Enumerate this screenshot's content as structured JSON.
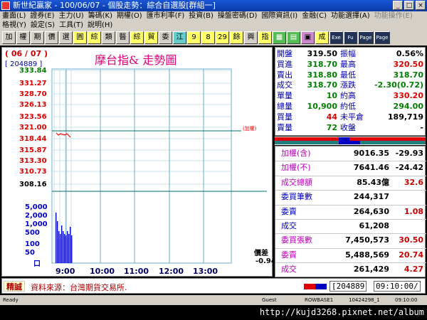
{
  "window": {
    "title": "新世紀贏家 - 100/06/07 - 個股走勢：綜合自選股[群組一]",
    "minimize": "_",
    "maximize": "□",
    "close": "×"
  },
  "menu": {
    "row1": [
      "畫面(L)",
      "證券(E)",
      "主力(U)",
      "籌碼(K)",
      "期權(O)",
      "匯市利率(F)",
      "投資(B)",
      "操盤密碼(D)",
      "國際資訊(I)",
      "金融(C)",
      "功能選擇(A)",
      "功能操作(E)"
    ],
    "row2": [
      "格視(Y)",
      "設定(S)",
      "工具(T)",
      "說明(H)"
    ]
  },
  "toolbar": [
    "加",
    "權",
    "期",
    "價",
    "選",
    "圓",
    "綜",
    "類",
    "醫",
    "綜",
    "貿",
    "委",
    "江",
    "9",
    "8",
    "29",
    "餘",
    "興",
    "指",
    "▦",
    "▤",
    "▣",
    "成",
    "Exe",
    "Fu",
    "Page",
    "Page"
  ],
  "chart": {
    "date": "( 06 / 07 )",
    "code": "[ 204889 ]",
    "title": "摩台指& 走勢圖",
    "price_ticks": [
      "333.84",
      "331.27",
      "328.70",
      "326.13",
      "323.56",
      "321.00",
      "318.44",
      "315.87",
      "313.30",
      "310.73",
      "308.16"
    ],
    "volume_ticks": [
      "5,000",
      "2,000",
      "1,000",
      "500",
      "100",
      "50",
      "口"
    ],
    "times": [
      "9:00",
      "10:00",
      "11:00",
      "12:00",
      "13:00"
    ],
    "ref_note": "(加權)",
    "spread_label": "價差",
    "spread_value": "-0.94"
  },
  "quote": {
    "rows": [
      {
        "l1": "開盤",
        "v1": "319.50",
        "l2": "振幅",
        "v2": "0.56%"
      },
      {
        "l1": "買進",
        "v1": "318.70",
        "l2": "最高",
        "v2": "320.50"
      },
      {
        "l1": "賣出",
        "v1": "318.80",
        "l2": "最低",
        "v2": "318.70"
      },
      {
        "l1": "成交",
        "v1": "318.70",
        "l2": "漲跌",
        "v2": "-2.30(0.72)"
      },
      {
        "l1": "單量",
        "v1": "10",
        "l2": "約高",
        "v2": "330.20"
      },
      {
        "l1": "總量",
        "v1": "10,900",
        "l2": "約低",
        "v2": "294.00"
      },
      {
        "l1": "買量",
        "v1": "44",
        "l2": "未平倉",
        "v2": "189,719"
      },
      {
        "l1": "賣量",
        "v1": "72",
        "l2": "收盤",
        "v2": "-"
      }
    ]
  },
  "index": {
    "rows": [
      {
        "label": "加權(含)",
        "value": "9016.35",
        "change": "-29.93",
        "lc": "#c000c0",
        "cc": "#000"
      },
      {
        "label": "加權(不)",
        "value": "7641.46",
        "change": "-24.42",
        "lc": "#c000c0",
        "cc": "#000"
      },
      {
        "label": "成交總額",
        "value": "85.43億",
        "change": "32.6",
        "lc": "#c000c0",
        "cc": "#c00"
      },
      {
        "label": "委買筆數",
        "value": "244,317",
        "change": "",
        "lc": "#0000c0",
        "cc": "#c00"
      },
      {
        "label": "委賣",
        "value": "264,630",
        "change": "1.08",
        "lc": "#0000c0",
        "cc": "#c00"
      },
      {
        "label": "成交",
        "value": "61,208",
        "change": "",
        "lc": "#0000c0",
        "cc": "#c00"
      },
      {
        "label": "委買張數",
        "value": "7,450,573",
        "change": "30.50",
        "lc": "#c000c0",
        "cc": "#c00"
      },
      {
        "label": "委賣",
        "value": "5,488,569",
        "change": "20.74",
        "lc": "#c000c0",
        "cc": "#c00"
      },
      {
        "label": "成交",
        "value": "261,429",
        "change": "4.27",
        "lc": "#c000c0",
        "cc": "#c00"
      }
    ]
  },
  "footer": {
    "tag": "精誠",
    "source": "資料來源：台灣期貨交易所.",
    "code": "[204889",
    "clock": "09:10:00/"
  },
  "status": {
    "ready": "Ready",
    "guest": "Guest",
    "server": "ROWBASE1",
    "id": "10424298_1",
    "time": "09:10:00"
  },
  "url": "http://kujd3268.pixnet.net/album",
  "colors": {
    "up": "#ff0000",
    "down": "#008000",
    "vol": "#0000cc",
    "grid": "#6aaccc",
    "ref": "#007070"
  }
}
